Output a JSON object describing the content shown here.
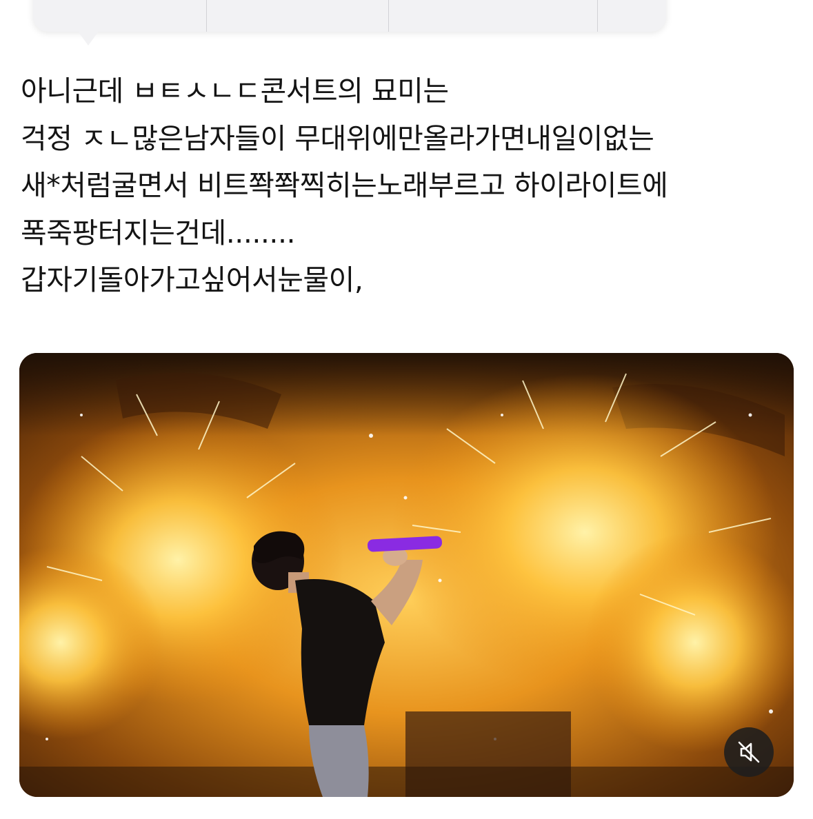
{
  "context_menu": {
    "items": [
      {
        "label": ""
      },
      {
        "label": ""
      },
      {
        "label": ""
      },
      {
        "label": ""
      }
    ]
  },
  "post": {
    "lines": [
      "아니근데 ㅂㅌㅅㄴㄷ콘서트의 묘미는",
      "걱정 ㅈㄴ많은남자들이 무대위에만올라가면내일이없는",
      "새*처럼굴면서 비트쫙쫙찍히는노래부르고 하이라이트에",
      "폭죽팡터지는건데........",
      "갑자기돌아가고싶어서눈물이,"
    ]
  },
  "media": {
    "type": "video",
    "mute_icon": "speaker-muted-icon",
    "colors": {
      "fire": "#f5a623",
      "fire_bright": "#ffe27a",
      "mic": "#8a2be2"
    }
  }
}
